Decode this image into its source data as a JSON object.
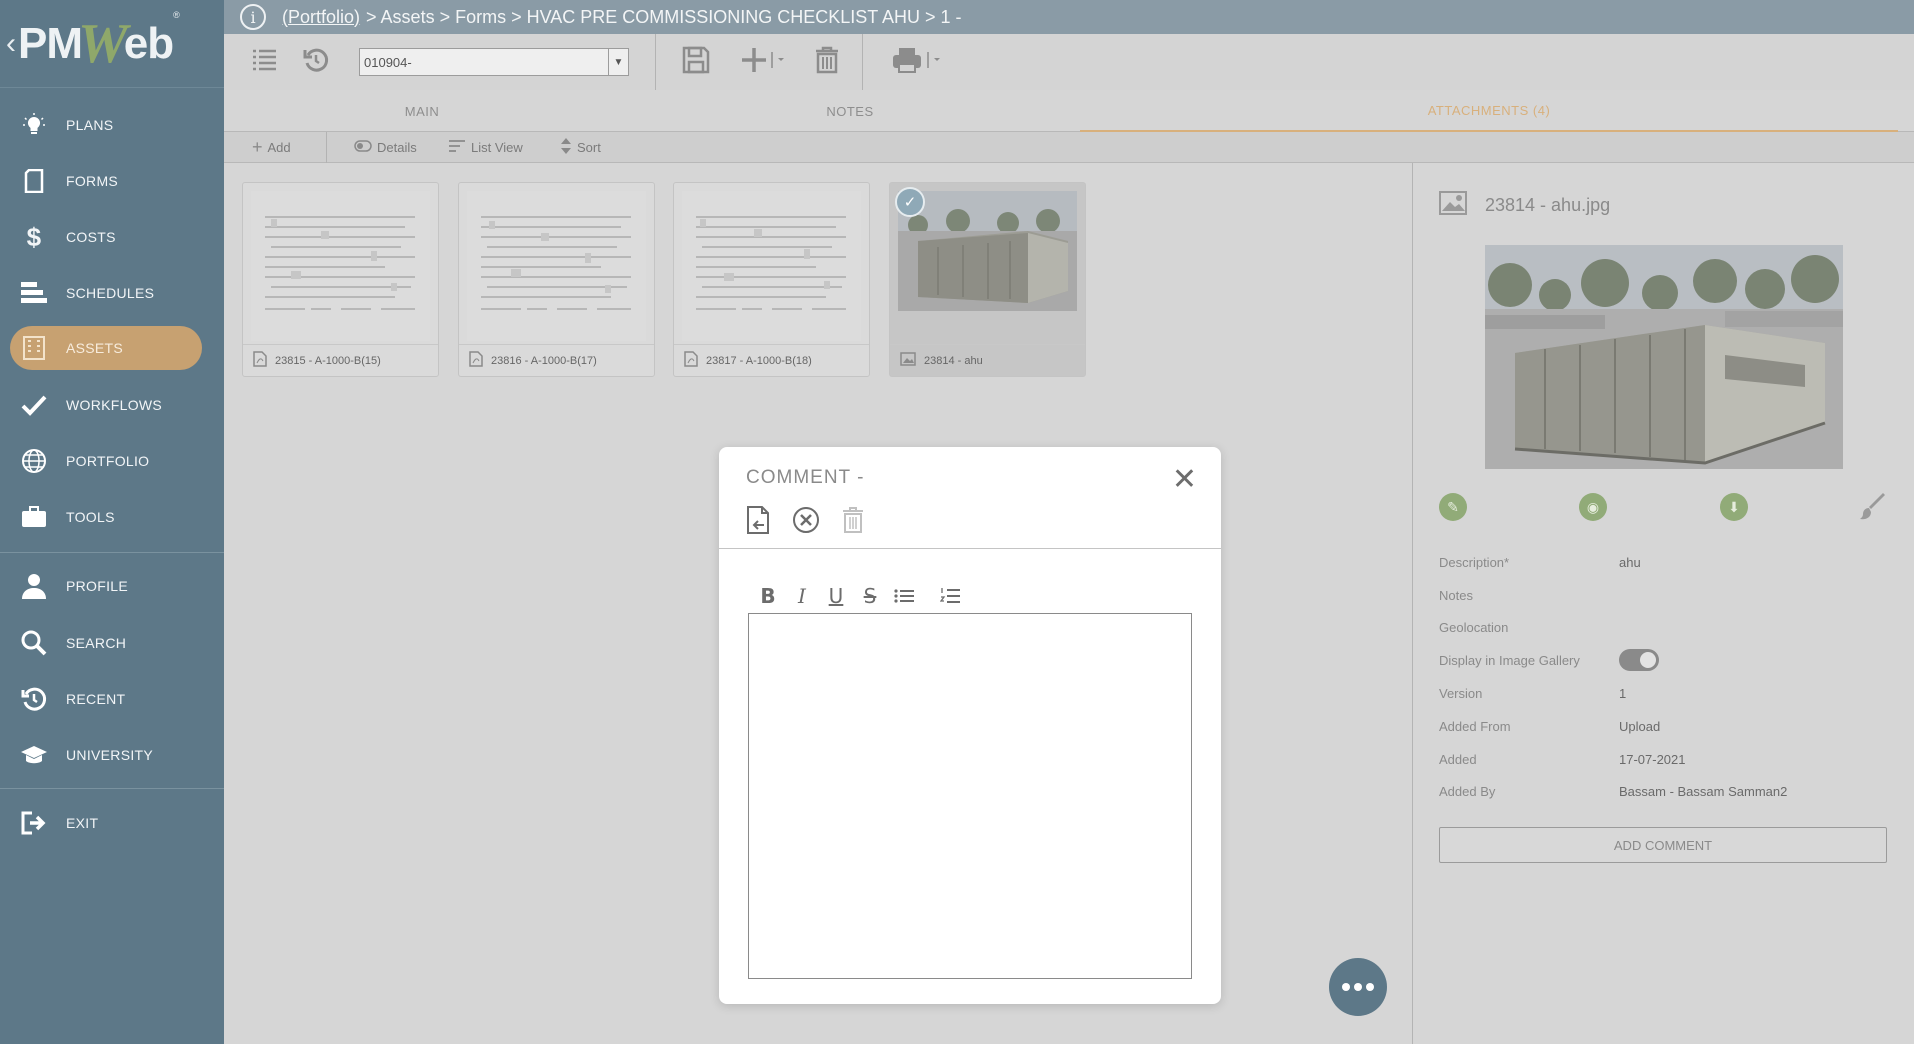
{
  "sidebar": {
    "logo_left": "PM",
    "logo_w": "W",
    "logo_right": "eb",
    "logo_reg": "®",
    "items": [
      {
        "label": "PLANS",
        "icon": "lightbulb-icon"
      },
      {
        "label": "FORMS",
        "icon": "document-icon"
      },
      {
        "label": "COSTS",
        "icon": "dollar-icon"
      },
      {
        "label": "SCHEDULES",
        "icon": "gantt-icon"
      },
      {
        "label": "ASSETS",
        "icon": "building-icon"
      },
      {
        "label": "WORKFLOWS",
        "icon": "checkmark-icon"
      },
      {
        "label": "PORTFOLIO",
        "icon": "globe-icon"
      },
      {
        "label": "TOOLS",
        "icon": "briefcase-icon"
      },
      {
        "label": "PROFILE",
        "icon": "person-icon"
      },
      {
        "label": "SEARCH",
        "icon": "search-icon"
      },
      {
        "label": "RECENT",
        "icon": "history-icon"
      },
      {
        "label": "UNIVERSITY",
        "icon": "graduation-cap-icon"
      },
      {
        "label": "EXIT",
        "icon": "exit-icon"
      }
    ],
    "active": "ASSETS"
  },
  "breadcrumb": {
    "portfolio": "(Portfolio)",
    "rest": "> Assets > Forms > HVAC PRE COMMISSIONING CHECKLIST AHU > 1 -"
  },
  "toolbar": {
    "record_value": "010904-"
  },
  "tabs": [
    {
      "label": "MAIN"
    },
    {
      "label": "NOTES"
    },
    {
      "label": "ATTACHMENTS (4)"
    }
  ],
  "subtoolbar": {
    "add": "Add",
    "details": "Details",
    "list_view": "List View",
    "sort": "Sort"
  },
  "attachments": [
    {
      "label": "23815 - A-1000-B(15)",
      "type": "pdf"
    },
    {
      "label": "23816 - A-1000-B(17)",
      "type": "pdf"
    },
    {
      "label": "23817 - A-1000-B(18)",
      "type": "pdf"
    },
    {
      "label": "23814 - ahu",
      "type": "image",
      "selected": true
    }
  ],
  "details": {
    "title": "23814 - ahu.jpg",
    "fields": [
      {
        "label": "Description*",
        "value": "ahu"
      },
      {
        "label": "Notes",
        "value": ""
      },
      {
        "label": "Geolocation",
        "value": ""
      },
      {
        "label": "Display in Image Gallery",
        "value": ""
      },
      {
        "label": "Version",
        "value": "1"
      },
      {
        "label": "Added From",
        "value": "Upload"
      },
      {
        "label": "Added",
        "value": "17-07-2021"
      },
      {
        "label": "Added By",
        "value": "Bassam - Bassam Samman2"
      }
    ],
    "display_in_gallery": true,
    "add_comment": "ADD COMMENT"
  },
  "modal": {
    "title": "COMMENT -",
    "editor_value": ""
  },
  "colors": {
    "sidebar": "#5d7888",
    "accent": "#c7a171",
    "action_green": "#91ab78"
  }
}
